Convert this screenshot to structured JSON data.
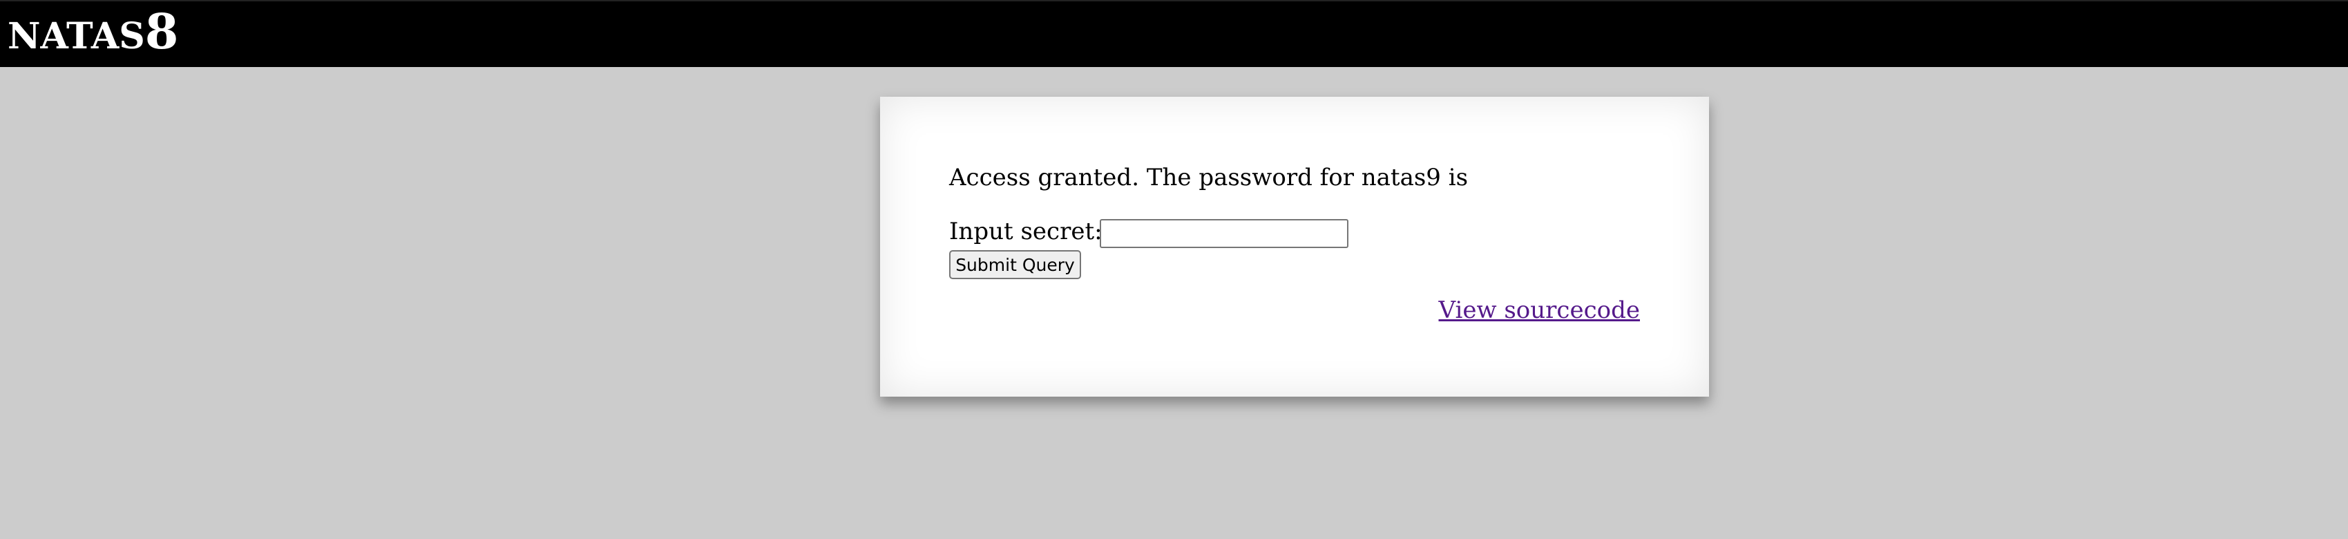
{
  "header": {
    "title_word": "NATAS",
    "title_number": "8",
    "background_color": "#000000",
    "text_color": "#ffffff"
  },
  "page": {
    "background_color": "#cccccc"
  },
  "content": {
    "message": "Access granted. The password for natas9 is",
    "form": {
      "label": "Input secret:",
      "input_value": "",
      "submit_label": "Submit Query"
    },
    "view_source_link": "View sourcecode",
    "link_color": "#551a8b"
  }
}
